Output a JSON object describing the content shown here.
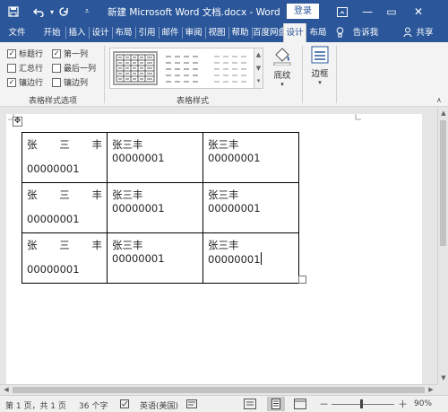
{
  "titlebar": {
    "save_icon": "save-icon",
    "undo_icon": "undo-icon",
    "redo_icon": "redo-icon",
    "customize_icon": "customize-qat-icon",
    "title": "新建 Microsoft Word 文档.docx  -  Word",
    "login": "登录",
    "ribbon_display_icon": "ribbon-display-icon",
    "minimize": "—",
    "restore": "▭",
    "close": "✕"
  },
  "tabs": {
    "file": "文件",
    "home": "开始",
    "insert": "插入",
    "design": "设计",
    "layout": "布局",
    "references": "引用",
    "mailings": "邮件",
    "review": "审阅",
    "view": "视图",
    "help": "帮助",
    "baidu": "百度网盘",
    "table_design": "设计",
    "table_layout": "布局",
    "tellme": "告诉我",
    "share": "共享"
  },
  "ribbon": {
    "options": {
      "header_row": "标题行",
      "first_column": "第一列",
      "total_row": "汇总行",
      "last_column": "最后一列",
      "banded_rows": "镶边行",
      "banded_columns": "镶边列",
      "header_row_checked": true,
      "first_column_checked": true,
      "total_row_checked": false,
      "last_column_checked": false,
      "banded_rows_checked": true,
      "banded_columns_checked": false
    },
    "options_group_label": "表格样式选项",
    "styles_group_label": "表格样式",
    "shading_label": "底纹",
    "borders_label": "边框"
  },
  "table": {
    "rows": [
      [
        "张　　三　　丰 00000001",
        "张三丰 00000001",
        "张三丰 00000001"
      ],
      [
        "张　　三　　丰 00000001",
        "张三丰 00000001",
        "张三丰 00000001"
      ],
      [
        "张　　三　　丰 00000001",
        "张三丰 00000001",
        "张三丰 00000001"
      ]
    ],
    "c1_line1": "张　　三　　丰",
    "c1_line2": "00000001",
    "cell": "张三丰 00000001"
  },
  "status": {
    "page": "第 1 页，共 1 页",
    "words": "36 个字",
    "language": "英语(美国)",
    "zoom": "90%",
    "zoom_minus": "－",
    "zoom_plus": "＋"
  }
}
